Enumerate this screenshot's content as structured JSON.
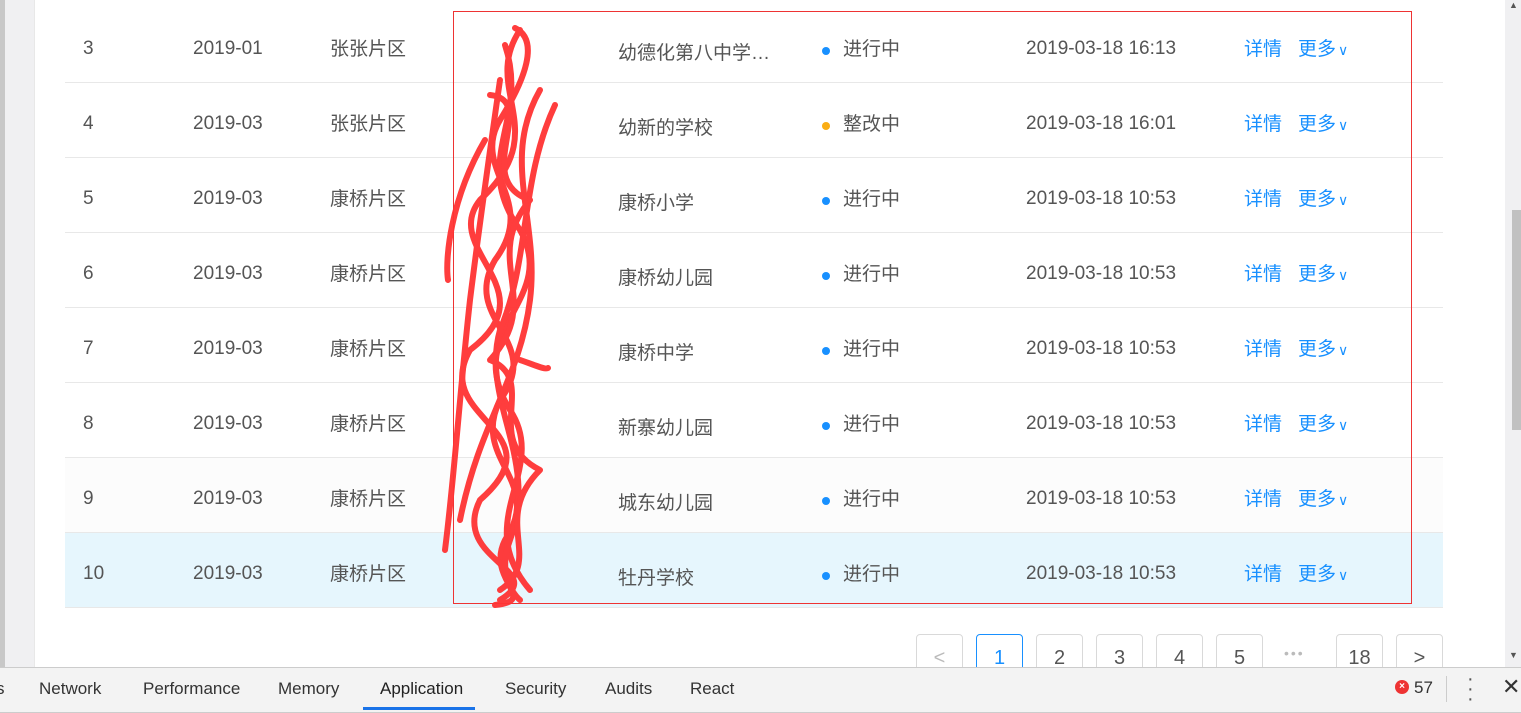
{
  "table": {
    "rows": [
      {
        "index": "3",
        "date": "2019-01",
        "district": "张张片区",
        "school": "幼德化第八中学…",
        "status": "进行中",
        "status_color": "#1890ff",
        "time": "2019-03-18 16:13"
      },
      {
        "index": "4",
        "date": "2019-03",
        "district": "张张片区",
        "school": "幼新的学校",
        "status": "整改中",
        "status_color": "#faad14",
        "time": "2019-03-18 16:01"
      },
      {
        "index": "5",
        "date": "2019-03",
        "district": "康桥片区",
        "school": "康桥小学",
        "status": "进行中",
        "status_color": "#1890ff",
        "time": "2019-03-18 10:53"
      },
      {
        "index": "6",
        "date": "2019-03",
        "district": "康桥片区",
        "school": "康桥幼儿园",
        "status": "进行中",
        "status_color": "#1890ff",
        "time": "2019-03-18 10:53"
      },
      {
        "index": "7",
        "date": "2019-03",
        "district": "康桥片区",
        "school": "康桥中学",
        "status": "进行中",
        "status_color": "#1890ff",
        "time": "2019-03-18 10:53"
      },
      {
        "index": "8",
        "date": "2019-03",
        "district": "康桥片区",
        "school": "新寨幼儿园",
        "status": "进行中",
        "status_color": "#1890ff",
        "time": "2019-03-18 10:53"
      },
      {
        "index": "9",
        "date": "2019-03",
        "district": "康桥片区",
        "school": "城东幼儿园",
        "status": "进行中",
        "status_color": "#1890ff",
        "time": "2019-03-18 10:53"
      },
      {
        "index": "10",
        "date": "2019-03",
        "district": "康桥片区",
        "school": "牡丹学校",
        "status": "进行中",
        "status_color": "#1890ff",
        "time": "2019-03-18 10:53"
      }
    ],
    "detail_label": "详情",
    "more_label": "更多",
    "more_icon": "chevron-down-icon"
  },
  "pagination": {
    "prev": "<",
    "next": ">",
    "pages": [
      "1",
      "2",
      "3",
      "4",
      "5"
    ],
    "ellipsis": "•••",
    "last": "18",
    "current": "1"
  },
  "devtools": {
    "tabs": [
      "s",
      "Network",
      "Performance",
      "Memory",
      "Application",
      "Security",
      "Audits",
      "React"
    ],
    "active_tab": "Application",
    "error_count": "57",
    "accent": "#1a73e8"
  }
}
